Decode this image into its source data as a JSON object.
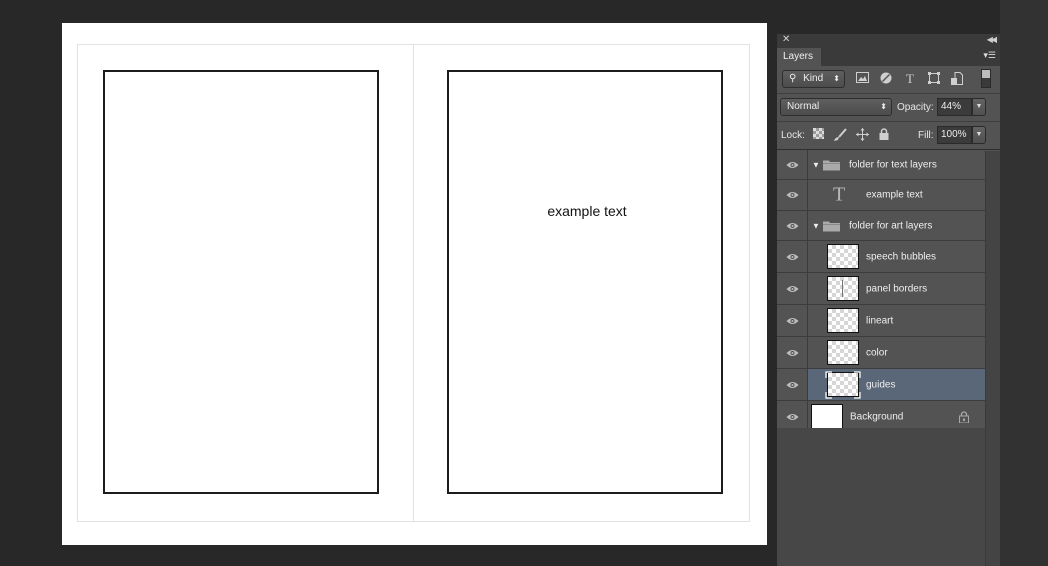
{
  "canvas": {
    "text_layer_content": "example text"
  },
  "layers_panel": {
    "tab_label": "Layers",
    "close_glyph": "✕",
    "collapse_glyph": "◀◀",
    "menu_glyph": "▾☰",
    "filter": {
      "kind_label": "Kind",
      "search_glyph": "⚲",
      "icons": [
        "image-filter-icon",
        "adjustment-filter-icon",
        "type-filter-icon",
        "shape-filter-icon",
        "smart-object-filter-icon"
      ]
    },
    "blend_mode": "Normal",
    "opacity_label": "Opacity:",
    "opacity_value": "44%",
    "lock_label": "Lock:",
    "fill_label": "Fill:",
    "fill_value": "100%",
    "layers": [
      {
        "name": "folder for text layers",
        "type": "group",
        "expanded": true,
        "visible": true
      },
      {
        "name": "example text",
        "type": "text",
        "visible": true,
        "indent": 1
      },
      {
        "name": "folder for art layers",
        "type": "group",
        "expanded": true,
        "visible": true
      },
      {
        "name": "speech bubbles",
        "type": "pixel",
        "visible": true,
        "indent": 1
      },
      {
        "name": "panel borders",
        "type": "pixel",
        "visible": true,
        "indent": 1
      },
      {
        "name": "lineart",
        "type": "pixel",
        "visible": true,
        "indent": 1
      },
      {
        "name": "color",
        "type": "pixel",
        "visible": true,
        "indent": 1
      },
      {
        "name": "guides",
        "type": "pixel",
        "visible": true,
        "indent": 1,
        "selected": true
      },
      {
        "name": "Background",
        "type": "background",
        "visible": true,
        "locked": true
      }
    ]
  },
  "colors": {
    "selected_row": "#5a6779",
    "panel_bg": "#535353",
    "workspace_bg": "#282828"
  }
}
